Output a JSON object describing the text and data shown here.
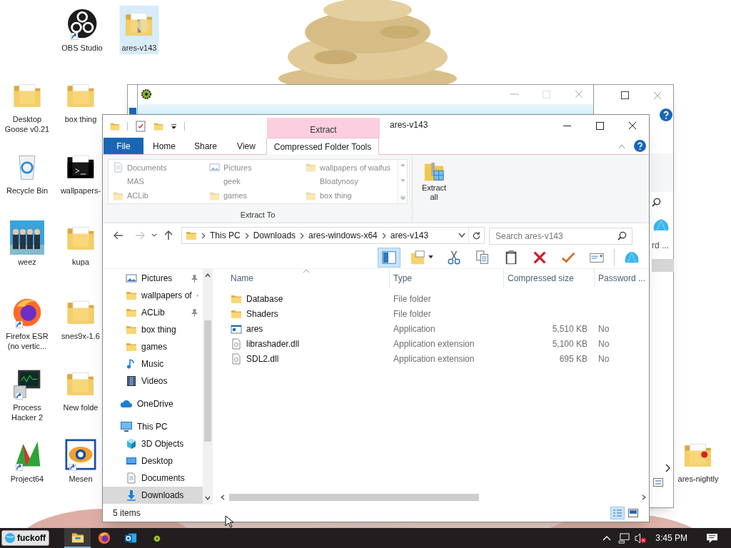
{
  "desktop_icons": [
    {
      "label": "OBS Studio",
      "kind": "obs",
      "shortcut": true,
      "selected": false
    },
    {
      "label": "ares-v143",
      "kind": "zip-folder",
      "shortcut": false,
      "selected": true
    },
    {
      "label": "Desktop Goose v0.21",
      "kind": "folder",
      "shortcut": false,
      "selected": false
    },
    {
      "label": "box thing",
      "kind": "folder",
      "shortcut": false,
      "selected": false
    },
    {
      "label": "Recycle Bin",
      "kind": "recycle-bin",
      "shortcut": false,
      "selected": false
    },
    {
      "label": "wallpapers-",
      "kind": "dark-folder",
      "shortcut": false,
      "selected": false
    },
    {
      "label": "weez",
      "kind": "picture",
      "shortcut": false,
      "selected": false
    },
    {
      "label": "kupa",
      "kind": "folder",
      "shortcut": false,
      "selected": false
    },
    {
      "label": "Firefox ESR (no vertic...",
      "kind": "firefox",
      "shortcut": true,
      "selected": false
    },
    {
      "label": "snes9x-1.6",
      "kind": "folder",
      "shortcut": false,
      "selected": false
    },
    {
      "label": "Process Hacker 2",
      "kind": "monitor",
      "shortcut": true,
      "selected": false
    },
    {
      "label": "New folde",
      "kind": "folder",
      "shortcut": false,
      "selected": false
    },
    {
      "label": "Project64",
      "kind": "project64",
      "shortcut": true,
      "selected": false
    },
    {
      "label": "Mesen",
      "kind": "mesen",
      "shortcut": true,
      "selected": false
    },
    {
      "label": "ares-nightly",
      "kind": "pin-folder",
      "shortcut": false,
      "selected": false
    }
  ],
  "explorer": {
    "title": "ares-v143",
    "context_tab": "Extract",
    "file_menu": "File",
    "ribbon_tabs": [
      {
        "label": "Home",
        "selected": false
      },
      {
        "label": "Share",
        "selected": false
      },
      {
        "label": "View",
        "selected": false
      },
      {
        "label": "Compressed Folder Tools",
        "selected": true
      }
    ],
    "extract_to": {
      "label": "Extract To",
      "locations": [
        {
          "label": "Documents",
          "kind": "document"
        },
        {
          "label": "Pictures",
          "kind": "pictures"
        },
        {
          "label": "wallpapers of waifus",
          "kind": "folder"
        },
        {
          "label": "MAS",
          "kind": "plain"
        },
        {
          "label": "geek",
          "kind": "plain"
        },
        {
          "label": "Bloatynosy",
          "kind": "plain"
        },
        {
          "label": "ACLib",
          "kind": "folder"
        },
        {
          "label": "games",
          "kind": "folder"
        },
        {
          "label": "box thing",
          "kind": "folder"
        }
      ]
    },
    "extract_all": "Extract all",
    "breadcrumbs": [
      "This PC",
      "Downloads",
      "ares-windows-x64",
      "ares-v143"
    ],
    "search": {
      "placeholder": "Search ares-v143"
    },
    "toolbar": [
      {
        "kind": "preview-pane",
        "on": true
      },
      {
        "kind": "new-folder",
        "on": false
      },
      {
        "kind": "cut",
        "on": false
      },
      {
        "kind": "copy",
        "on": false
      },
      {
        "kind": "paste",
        "on": false
      },
      {
        "kind": "delete",
        "on": false
      },
      {
        "kind": "check",
        "on": false
      },
      {
        "kind": "mail",
        "on": false
      },
      {
        "kind": "shell",
        "on": false
      }
    ],
    "quick_access": [
      {
        "label": "Pictures",
        "kind": "pictures",
        "pinned": true
      },
      {
        "label": "wallpapers of",
        "kind": "folder",
        "pinned": true
      },
      {
        "label": "ACLib",
        "kind": "folder",
        "pinned": true
      },
      {
        "label": "box thing",
        "kind": "folder",
        "pinned": false
      },
      {
        "label": "games",
        "kind": "folder",
        "pinned": false
      },
      {
        "label": "Music",
        "kind": "music",
        "pinned": false
      },
      {
        "label": "Videos",
        "kind": "videos",
        "pinned": false
      }
    ],
    "onedrive": {
      "label": "OneDrive"
    },
    "this_pc": {
      "label": "This PC",
      "children": [
        {
          "label": "3D Objects",
          "kind": "cube",
          "selected": false
        },
        {
          "label": "Desktop",
          "kind": "desktop",
          "selected": false
        },
        {
          "label": "Documents",
          "kind": "document",
          "selected": false
        },
        {
          "label": "Downloads",
          "kind": "download",
          "selected": true
        }
      ]
    },
    "columns": [
      "Name",
      "Type",
      "Compressed size",
      "Password ..."
    ],
    "rows": [
      {
        "name": "Database",
        "kind": "folder",
        "type": "File folder"
      },
      {
        "name": "Shaders",
        "kind": "folder",
        "type": "File folder"
      },
      {
        "name": "ares",
        "kind": "app",
        "type": "Application",
        "size": "5,510 KB",
        "password": "No"
      },
      {
        "name": "librashader.dll",
        "kind": "dll",
        "type": "Application extension",
        "size": "5,100 KB",
        "password": "No"
      },
      {
        "name": "SDL2.dll",
        "kind": "dll",
        "type": "Application extension",
        "size": "695 KB",
        "password": "No"
      }
    ],
    "status": "5 items"
  },
  "background_window": {
    "column_fragment": "rd ..."
  },
  "taskbar": {
    "start_label": "fuckoff",
    "apps": [
      {
        "kind": "explorer",
        "active": true
      },
      {
        "kind": "firefox",
        "active": false
      },
      {
        "kind": "outlook",
        "active": false
      },
      {
        "kind": "ares",
        "active": false
      }
    ],
    "clock": "3:45 PM"
  }
}
